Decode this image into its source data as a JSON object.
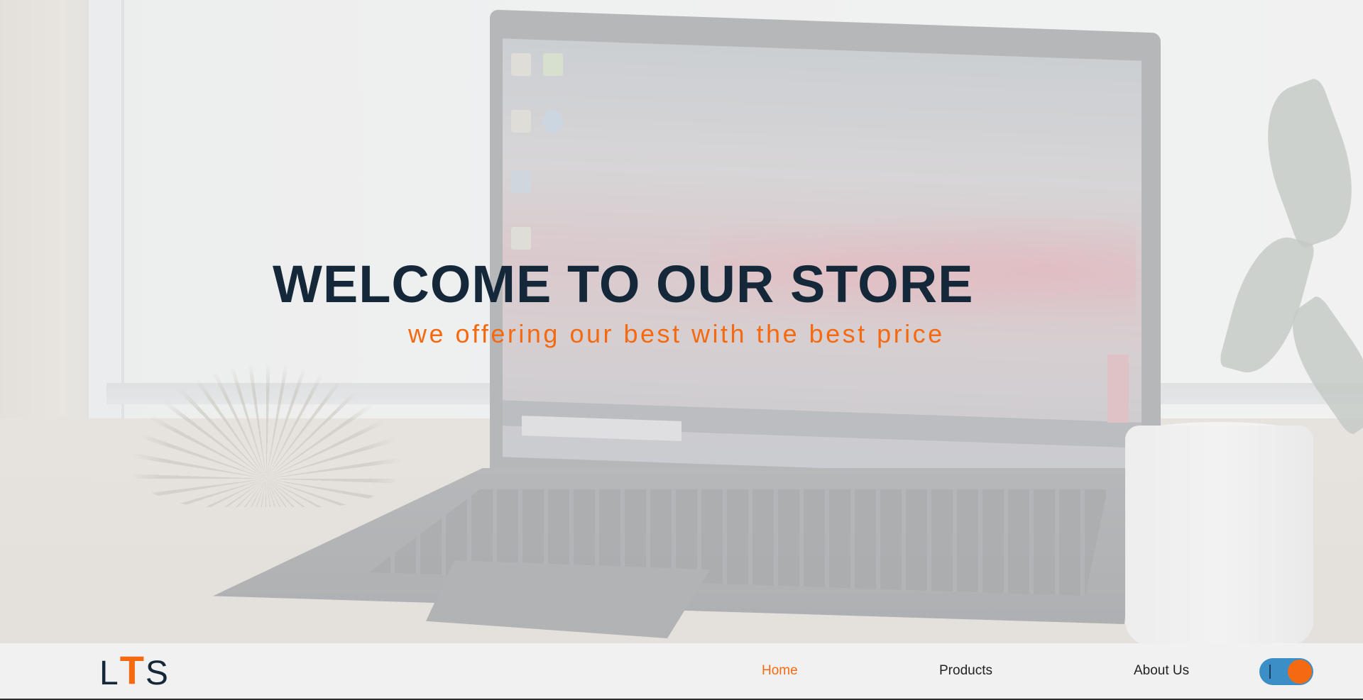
{
  "hero": {
    "title": "WELCOME TO OUR STORE",
    "subtitle": "we offering our best with the best price",
    "background_image": "laptop-on-desk-photo"
  },
  "navbar": {
    "logo": {
      "first": "L",
      "middle": "T",
      "last": "S"
    },
    "links": [
      {
        "label": "Home",
        "active": true
      },
      {
        "label": "Products",
        "active": false
      },
      {
        "label": "About Us",
        "active": false
      }
    ],
    "theme_toggle": {
      "icon": "theme-toggle-icon",
      "state": "on"
    }
  },
  "colors": {
    "accent": "#f56a10",
    "heading": "#14283a",
    "navbar_bg": "#f1f1f1",
    "toggle_track": "#3b8fc6"
  }
}
